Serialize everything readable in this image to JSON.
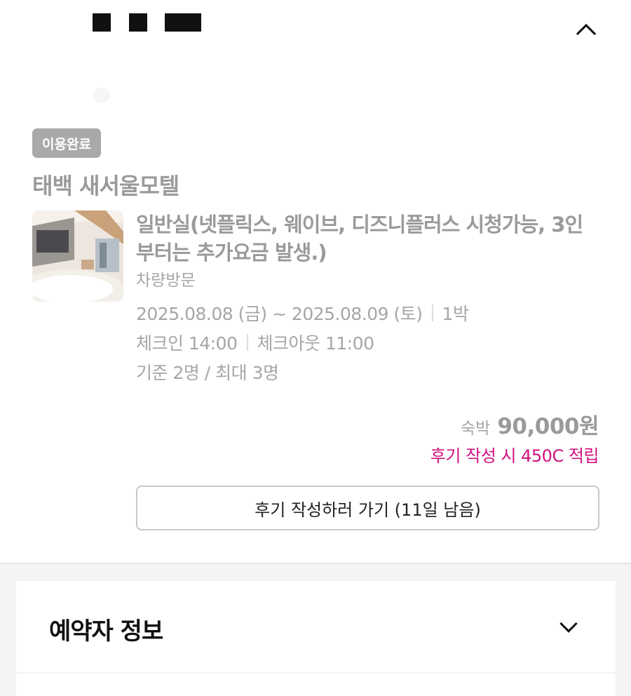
{
  "header": {
    "collapse_icon": "chevron-up-icon"
  },
  "reservation": {
    "status_badge": "이용완료",
    "hotel_name": "태백 새서울모텔",
    "room_name": "일반실(넷플릭스, 웨이브, 디즈니플러스 시청가능, 3인 부터는 추가요금 발생.)",
    "visit_type": "차량방문",
    "dates": "2025.08.08 (금) ~ 2025.08.09 (토)",
    "nights": "1박",
    "checkin": "체크인 14:00",
    "checkout": "체크아웃 11:00",
    "occupancy": "기준 2명 / 최대 3명",
    "price_label": "숙박",
    "price_value": "90,000원",
    "reward_text": "후기 작성 시 450C 적립",
    "review_button": "후기 작성하러 가기 (11일 남음)"
  },
  "booker_section": {
    "title": "예약자 정보",
    "toggle_icon": "chevron-down-icon"
  },
  "colors": {
    "accent": "#d1117e",
    "badge_bg": "#a9a9a9",
    "muted_text": "#9a9a9a"
  }
}
